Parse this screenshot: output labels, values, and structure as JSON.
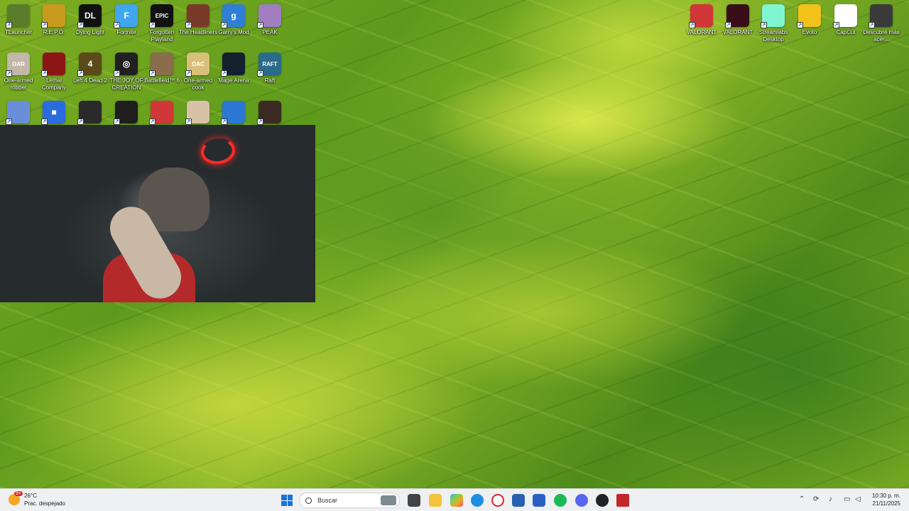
{
  "desktop": {
    "icons": [
      {
        "label": "TLauncher",
        "icon": "tlauncher-icon",
        "color": "#5a7d2c",
        "glyph": ""
      },
      {
        "label": "R.E.P.O.",
        "icon": "repo-icon",
        "color": "#c89b1e",
        "glyph": ""
      },
      {
        "label": "Dying Light",
        "icon": "dying-light-icon",
        "color": "#111111",
        "glyph": "DL"
      },
      {
        "label": "Fortnite",
        "icon": "fortnite-icon",
        "color": "#3fa6ef",
        "glyph": "F"
      },
      {
        "label": "Forgotten Playland",
        "icon": "epic-games-icon",
        "color": "#111111",
        "glyph": "EPIC"
      },
      {
        "label": "The Headliners",
        "icon": "headliners-icon",
        "color": "#7a3a2a",
        "glyph": ""
      },
      {
        "label": "Garry's Mod",
        "icon": "garrys-mod-icon",
        "color": "#2f7fd6",
        "glyph": "g"
      },
      {
        "label": "PEAK",
        "icon": "peak-icon",
        "color": "#a07ec0",
        "glyph": ""
      },
      {
        "label": "One-armed robber",
        "icon": "one-armed-robber-icon",
        "color": "#c2b7a8",
        "glyph": "OAR"
      },
      {
        "label": "Lethal Company",
        "icon": "lethal-company-icon",
        "color": "#8c1616",
        "glyph": ""
      },
      {
        "label": "Left 4 Dead 2",
        "icon": "left-4-dead-icon",
        "color": "#5b4a1a",
        "glyph": "4"
      },
      {
        "label": "THE JOY OF CREATION",
        "icon": "joy-of-creation-icon",
        "color": "#202020",
        "glyph": "◎"
      },
      {
        "label": "Battlefield™ 6",
        "icon": "battlefield-icon",
        "color": "#8a6d4a",
        "glyph": ""
      },
      {
        "label": "One-armed cook",
        "icon": "one-armed-cook-icon",
        "color": "#d9c07a",
        "glyph": "OAC"
      },
      {
        "label": "Mage Arena",
        "icon": "mage-arena-icon",
        "color": "#15202e",
        "glyph": ""
      },
      {
        "label": "Raft",
        "icon": "raft-icon",
        "color": "#2a6a8a",
        "glyph": "RAFT"
      },
      {
        "label": "",
        "icon": "fall-guys-icon",
        "color": "#6a8fd9",
        "glyph": ""
      },
      {
        "label": "",
        "icon": "roblox-icon",
        "color": "#2a6be0",
        "glyph": "■"
      },
      {
        "label": "",
        "icon": "skull-game-icon",
        "color": "#2a2a2a",
        "glyph": ""
      },
      {
        "label": "",
        "icon": "dead-by-daylight-icon",
        "color": "#1e1e1e",
        "glyph": ""
      },
      {
        "label": "",
        "icon": "riot-client-icon",
        "color": "#d13639",
        "glyph": ""
      },
      {
        "label": "",
        "icon": "feet-game-icon",
        "color": "#d7c2a8",
        "glyph": ""
      },
      {
        "label": "",
        "icon": "rocket-league-icon",
        "color": "#2a78d4",
        "glyph": ""
      },
      {
        "label": "",
        "icon": "horror-game-icon",
        "color": "#3a2a22",
        "glyph": ""
      }
    ],
    "right_icons": [
      {
        "label": "VALORANT",
        "icon": "riot-client-icon",
        "color": "#d13639"
      },
      {
        "label": "VALORANT",
        "icon": "valorant-icon",
        "color": "#3a0e18"
      },
      {
        "label": "Streamlabs Desktop",
        "icon": "streamlabs-icon",
        "color": "#80f5d2"
      },
      {
        "label": "Evoto",
        "icon": "evoto-icon",
        "color": "#f2c21a"
      },
      {
        "label": "CapCut",
        "icon": "capcut-icon",
        "color": "#ffffff"
      },
      {
        "label": "Descubre más acer...",
        "icon": "acer-discover-icon",
        "color": "#3a3a3a"
      }
    ]
  },
  "taskbar": {
    "weather": {
      "temperature": "26°C",
      "condition": "Prac. despejado",
      "badge": "9+"
    },
    "search_placeholder": "Buscar",
    "clock": {
      "time": "10:30 p. m.",
      "date": "21/11/2025"
    }
  }
}
